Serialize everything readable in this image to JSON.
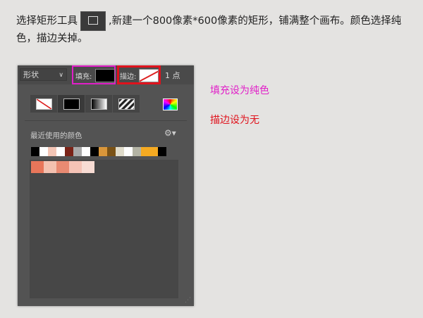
{
  "intro": {
    "part1": "选择矩形工具",
    "part2": ",新建一个800像素*600像素的矩形，铺满整个画布。颜色选择纯色，描边关掉。",
    "tool_icon": "rectangle-tool-icon"
  },
  "panel": {
    "shape_mode": "形状",
    "fill_label": "填充:",
    "stroke_label": "描边:",
    "stroke_width": "1 点",
    "recent_colors_label": "最近使用的颜色",
    "recent_colors": [
      "#000000",
      "#ffffff",
      "#f3c5b5",
      "#ffffff",
      "#7a2318",
      "#a9a9a9",
      "#ffffff",
      "#000000",
      "#d9963a",
      "#7a5216",
      "#e0dccb",
      "#ffffff",
      "#b3b3a4",
      "#f5aa22",
      "#f5aa22",
      "#000000"
    ],
    "swatches": [
      "#e8765a",
      "#f3c1b0",
      "#e88a72",
      "#f5c3b6",
      "#f8dcd4"
    ],
    "fill_color": "#000000"
  },
  "notes": {
    "fill": "填充设为纯色",
    "stroke": "描边设为无",
    "fill_color": "#e11ec8",
    "stroke_color": "#e0121c"
  }
}
